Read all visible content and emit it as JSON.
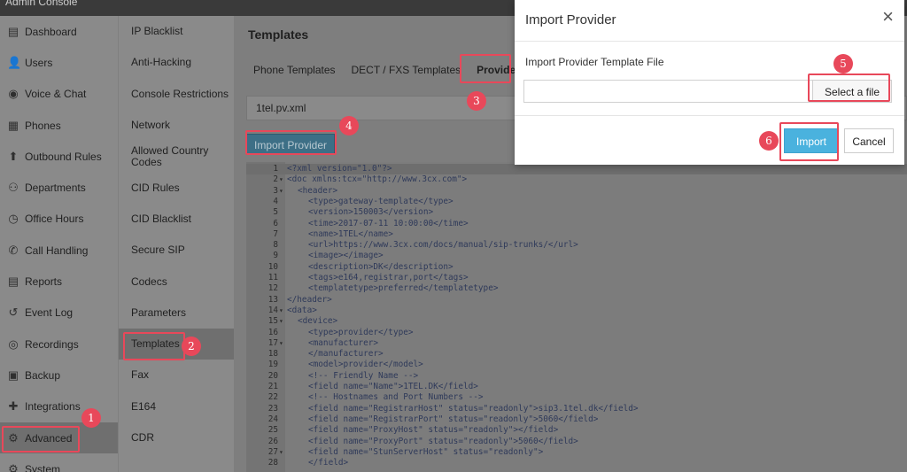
{
  "topbar": {
    "title": "Admin Console"
  },
  "sidebar": {
    "items": [
      {
        "label": "Dashboard",
        "icon": "dashboard-icon",
        "glyph": "▤"
      },
      {
        "label": "Users",
        "icon": "user-icon",
        "glyph": "👤"
      },
      {
        "label": "Voice & Chat",
        "icon": "voice-chat-icon",
        "glyph": "◉"
      },
      {
        "label": "Phones",
        "icon": "phone-icon",
        "glyph": "▦"
      },
      {
        "label": "Outbound Rules",
        "icon": "arrow-up-icon",
        "glyph": "⬆"
      },
      {
        "label": "Departments",
        "icon": "departments-icon",
        "glyph": "⚇"
      },
      {
        "label": "Office Hours",
        "icon": "clock-icon",
        "glyph": "◷"
      },
      {
        "label": "Call Handling",
        "icon": "phone-handset-icon",
        "glyph": "✆"
      },
      {
        "label": "Reports",
        "icon": "reports-icon",
        "glyph": "▤"
      },
      {
        "label": "Event Log",
        "icon": "history-icon",
        "glyph": "↺"
      },
      {
        "label": "Recordings",
        "icon": "record-icon",
        "glyph": "◎"
      },
      {
        "label": "Backup",
        "icon": "backup-icon",
        "glyph": "▣"
      },
      {
        "label": "Integrations",
        "icon": "puzzle-icon",
        "glyph": "✚"
      },
      {
        "label": "Advanced",
        "icon": "gears-icon",
        "glyph": "⚙"
      },
      {
        "label": "System",
        "icon": "system-icon",
        "glyph": "⚙"
      }
    ]
  },
  "subnav": {
    "items": [
      {
        "label": "IP Blacklist"
      },
      {
        "label": "Anti-Hacking"
      },
      {
        "label": "Console Restrictions"
      },
      {
        "label": "Network"
      },
      {
        "label": "Allowed Country Codes"
      },
      {
        "label": "CID Rules"
      },
      {
        "label": "CID Blacklist"
      },
      {
        "label": "Secure SIP"
      },
      {
        "label": "Codecs"
      },
      {
        "label": "Parameters"
      },
      {
        "label": "Templates"
      },
      {
        "label": "Fax"
      },
      {
        "label": "E164"
      },
      {
        "label": "CDR"
      }
    ]
  },
  "main": {
    "title": "Templates",
    "tabs": [
      {
        "label": "Phone Templates"
      },
      {
        "label": "DECT / FXS Templates"
      },
      {
        "label": "Provider"
      }
    ],
    "file_name": "1tel.pv.xml",
    "import_button": "Import Provider"
  },
  "editor": {
    "lines": [
      {
        "n": "1",
        "fold": "",
        "indent": 0,
        "text": "<?xml version=\"1.0\"?>"
      },
      {
        "n": "2",
        "fold": "▾",
        "indent": 0,
        "text": "<doc xmlns:tcx=\"http://www.3cx.com\">"
      },
      {
        "n": "3",
        "fold": "▾",
        "indent": 1,
        "text": "<header>"
      },
      {
        "n": "4",
        "fold": "",
        "indent": 2,
        "text": "<type>gateway-template</type>"
      },
      {
        "n": "5",
        "fold": "",
        "indent": 2,
        "text": "<version>150003</version>"
      },
      {
        "n": "6",
        "fold": "",
        "indent": 2,
        "text": "<time>2017-07-11 10:00:00</time>"
      },
      {
        "n": "7",
        "fold": "",
        "indent": 2,
        "text": "<name>1TEL</name>"
      },
      {
        "n": "8",
        "fold": "",
        "indent": 2,
        "text": "<url>https://www.3cx.com/docs/manual/sip-trunks/</url>"
      },
      {
        "n": "9",
        "fold": "",
        "indent": 2,
        "text": "<image></image>"
      },
      {
        "n": "10",
        "fold": "",
        "indent": 2,
        "text": "<description>DK</description>"
      },
      {
        "n": "11",
        "fold": "",
        "indent": 2,
        "text": "<tags>e164,registrar,port</tags>"
      },
      {
        "n": "12",
        "fold": "",
        "indent": 2,
        "text": "<templatetype>preferred</templatetype>"
      },
      {
        "n": "13",
        "fold": "",
        "indent": 0,
        "text": "</header>"
      },
      {
        "n": "14",
        "fold": "▾",
        "indent": 0,
        "text": "<data>"
      },
      {
        "n": "15",
        "fold": "▾",
        "indent": 1,
        "text": "<device>"
      },
      {
        "n": "16",
        "fold": "",
        "indent": 2,
        "text": "<type>provider</type>"
      },
      {
        "n": "17",
        "fold": "▾",
        "indent": 2,
        "text": "<manufacturer>"
      },
      {
        "n": "18",
        "fold": "",
        "indent": 2,
        "text": "</manufacturer>"
      },
      {
        "n": "19",
        "fold": "",
        "indent": 2,
        "text": "<model>provider</model>"
      },
      {
        "n": "20",
        "fold": "",
        "indent": 2,
        "text": "<!-- Friendly Name -->"
      },
      {
        "n": "21",
        "fold": "",
        "indent": 2,
        "text": "<field name=\"Name\">1TEL.DK</field>"
      },
      {
        "n": "22",
        "fold": "",
        "indent": 2,
        "text": "<!-- Hostnames and Port Numbers -->"
      },
      {
        "n": "23",
        "fold": "",
        "indent": 2,
        "text": "<field name=\"RegistrarHost\" status=\"readonly\">sip3.1tel.dk</field>"
      },
      {
        "n": "24",
        "fold": "",
        "indent": 2,
        "text": "<field name=\"RegistrarPort\" status=\"readonly\">5060</field>"
      },
      {
        "n": "25",
        "fold": "",
        "indent": 2,
        "text": "<field name=\"ProxyHost\" status=\"readonly\"></field>"
      },
      {
        "n": "26",
        "fold": "",
        "indent": 2,
        "text": "<field name=\"ProxyPort\" status=\"readonly\">5060</field>"
      },
      {
        "n": "27",
        "fold": "▾",
        "indent": 2,
        "text": "<field name=\"StunServerHost\" status=\"readonly\">"
      },
      {
        "n": "28",
        "fold": "",
        "indent": 2,
        "text": "</field>"
      }
    ]
  },
  "dialog": {
    "title": "Import Provider",
    "close_glyph": "×",
    "field_label": "Import Provider Template File",
    "file_value": "",
    "select_file": "Select a file",
    "import": "Import",
    "cancel": "Cancel"
  },
  "steps": [
    "1",
    "2",
    "3",
    "4",
    "5",
    "6"
  ],
  "colors": {
    "highlight": "#e8485a",
    "primary": "#4ab2de",
    "import_provider": "#3d6f86"
  }
}
